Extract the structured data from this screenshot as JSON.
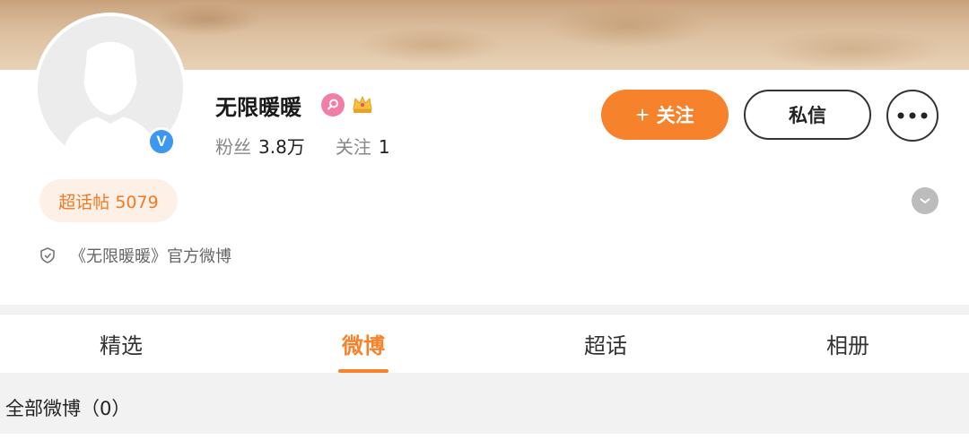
{
  "profile": {
    "name": "无限暖暖",
    "followers_label": "粉丝",
    "followers_value": "3.8万",
    "following_label": "关注",
    "following_value": "1",
    "verified": true
  },
  "actions": {
    "follow_label": "关注",
    "follow_plus": "+",
    "message_label": "私信"
  },
  "chip": {
    "supertopic": "超话帖 5079"
  },
  "official": {
    "text": "《无限暖暖》官方微博"
  },
  "tabs": [
    {
      "label": "精选",
      "active": false
    },
    {
      "label": "微博",
      "active": true
    },
    {
      "label": "超话",
      "active": false
    },
    {
      "label": "相册",
      "active": false
    }
  ],
  "section": {
    "title": "全部微博（0）"
  },
  "colors": {
    "accent": "#f7822c",
    "verified_blue": "#3b97f0",
    "female_pink": "#f17fa5"
  },
  "icons": [
    "verified-icon",
    "female-icon",
    "crown-icon",
    "more-icon",
    "chevron-down-icon",
    "shield-icon"
  ]
}
